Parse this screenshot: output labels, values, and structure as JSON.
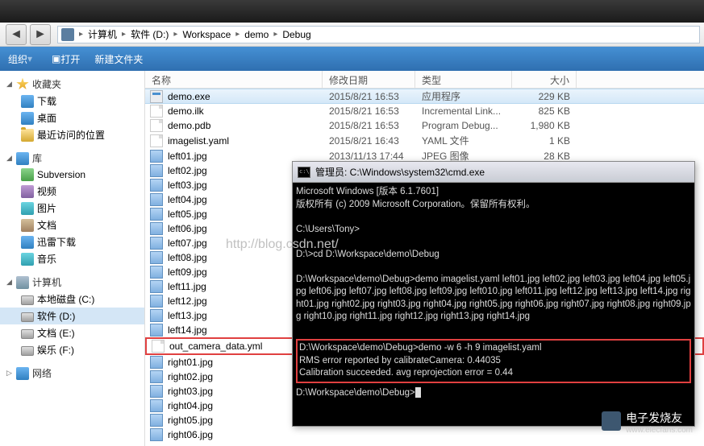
{
  "breadcrumb": {
    "items": [
      "计算机",
      "软件 (D:)",
      "Workspace",
      "demo",
      "Debug"
    ]
  },
  "toolbar": {
    "organize": "组织",
    "open": "打开",
    "new_folder": "新建文件夹"
  },
  "sidebar": {
    "favorites": {
      "label": "收藏夹",
      "items": [
        "下载",
        "桌面",
        "最近访问的位置"
      ]
    },
    "library": {
      "label": "库",
      "items": [
        "Subversion",
        "视频",
        "图片",
        "文档",
        "迅雷下载",
        "音乐"
      ]
    },
    "computer": {
      "label": "计算机",
      "items": [
        "本地磁盘 (C:)",
        "软件 (D:)",
        "文档 (E:)",
        "娱乐 (F:)"
      ]
    },
    "network": {
      "label": "网络"
    }
  },
  "columns": {
    "name": "名称",
    "date": "修改日期",
    "type": "类型",
    "size": "大小"
  },
  "files": [
    {
      "name": "demo.exe",
      "date": "2015/8/21 16:53",
      "type": "应用程序",
      "size": "229 KB",
      "icon": "exe",
      "selected": true
    },
    {
      "name": "demo.ilk",
      "date": "2015/8/21 16:53",
      "type": "Incremental Link...",
      "size": "825 KB",
      "icon": "file"
    },
    {
      "name": "demo.pdb",
      "date": "2015/8/21 16:53",
      "type": "Program Debug...",
      "size": "1,980 KB",
      "icon": "file"
    },
    {
      "name": "imagelist.yaml",
      "date": "2015/8/21 16:43",
      "type": "YAML 文件",
      "size": "1 KB",
      "icon": "file"
    },
    {
      "name": "left01.jpg",
      "date": "2013/11/13 17:44",
      "type": "JPEG 图像",
      "size": "28 KB",
      "icon": "jpg"
    },
    {
      "name": "left02.jpg",
      "date": "",
      "type": "",
      "size": "",
      "icon": "jpg"
    },
    {
      "name": "left03.jpg",
      "date": "",
      "type": "",
      "size": "",
      "icon": "jpg"
    },
    {
      "name": "left04.jpg",
      "date": "",
      "type": "",
      "size": "",
      "icon": "jpg"
    },
    {
      "name": "left05.jpg",
      "date": "",
      "type": "",
      "size": "",
      "icon": "jpg"
    },
    {
      "name": "left06.jpg",
      "date": "",
      "type": "",
      "size": "",
      "icon": "jpg"
    },
    {
      "name": "left07.jpg",
      "date": "",
      "type": "",
      "size": "",
      "icon": "jpg"
    },
    {
      "name": "left08.jpg",
      "date": "",
      "type": "",
      "size": "",
      "icon": "jpg"
    },
    {
      "name": "left09.jpg",
      "date": "",
      "type": "",
      "size": "",
      "icon": "jpg"
    },
    {
      "name": "left11.jpg",
      "date": "",
      "type": "",
      "size": "",
      "icon": "jpg"
    },
    {
      "name": "left12.jpg",
      "date": "",
      "type": "",
      "size": "",
      "icon": "jpg"
    },
    {
      "name": "left13.jpg",
      "date": "",
      "type": "",
      "size": "",
      "icon": "jpg"
    },
    {
      "name": "left14.jpg",
      "date": "",
      "type": "",
      "size": "",
      "icon": "jpg"
    },
    {
      "name": "out_camera_data.yml",
      "date": "",
      "type": "",
      "size": "",
      "icon": "file",
      "highlight": true
    },
    {
      "name": "right01.jpg",
      "date": "",
      "type": "",
      "size": "",
      "icon": "jpg"
    },
    {
      "name": "right02.jpg",
      "date": "",
      "type": "",
      "size": "",
      "icon": "jpg"
    },
    {
      "name": "right03.jpg",
      "date": "",
      "type": "",
      "size": "",
      "icon": "jpg"
    },
    {
      "name": "right04.jpg",
      "date": "",
      "type": "",
      "size": "",
      "icon": "jpg"
    },
    {
      "name": "right05.jpg",
      "date": "",
      "type": "",
      "size": "",
      "icon": "jpg"
    },
    {
      "name": "right06.jpg",
      "date": "",
      "type": "",
      "size": "",
      "icon": "jpg"
    }
  ],
  "console": {
    "title": "管理员: C:\\Windows\\system32\\cmd.exe",
    "line1": "Microsoft Windows [版本 6.1.7601]",
    "line2": "版权所有 (c) 2009 Microsoft Corporation。保留所有权利。",
    "line3": "C:\\Users\\Tony>",
    "line4": "D:\\>cd D:\\Workspace\\demo\\Debug",
    "line5": "D:\\Workspace\\demo\\Debug>demo imagelist.yaml left01.jpg left02.jpg left03.jpg left04.jpg left05.jpg left06.jpg left07.jpg left08.jpg left09.jpg left010.jpg left011.jpg left12.jpg left13.jpg left14.jpg right01.jpg right02.jpg right03.jpg right04.jpg right05.jpg right06.jpg right07.jpg right08.jpg right09.jpg right10.jpg right11.jpg right12.jpg right13.jpg right14.jpg",
    "hl1": "D:\\Workspace\\demo\\Debug>demo -w 6 -h 9 imagelist.yaml",
    "hl2": "RMS error reported by calibrateCamera: 0.44035",
    "hl3": "Calibration succeeded. avg reprojection error = 0.44",
    "prompt": "D:\\Workspace\\demo\\Debug>"
  },
  "watermarks": {
    "url": "http://blog.csdn.net/",
    "brand": "电子发烧友",
    "brand_sub": "www.elecfans.com"
  }
}
